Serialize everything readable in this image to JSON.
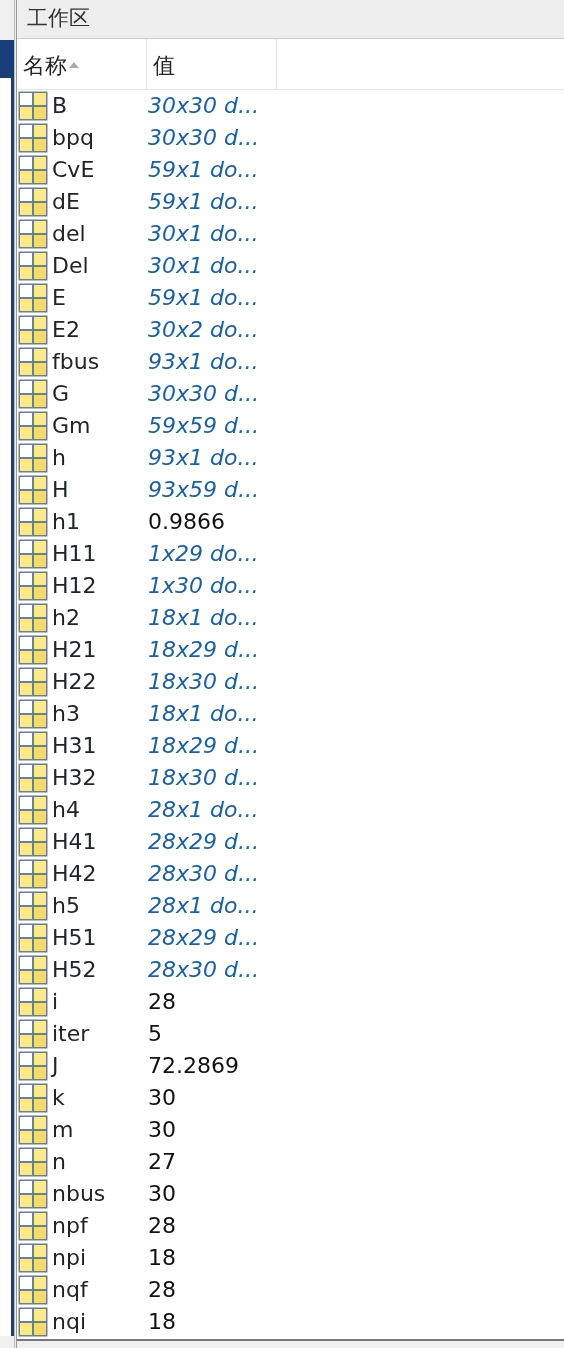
{
  "panel": {
    "title": "工作区"
  },
  "columns": [
    {
      "label": "名称",
      "sorted": true
    },
    {
      "label": "值",
      "sorted": false
    }
  ],
  "rows": [
    {
      "name": "B",
      "value": "30x30 d...",
      "kind": "summary"
    },
    {
      "name": "bpq",
      "value": "30x30 d...",
      "kind": "summary"
    },
    {
      "name": "CvE",
      "value": "59x1 do...",
      "kind": "summary"
    },
    {
      "name": "dE",
      "value": "59x1 do...",
      "kind": "summary"
    },
    {
      "name": "del",
      "value": "30x1 do...",
      "kind": "summary"
    },
    {
      "name": "Del",
      "value": "30x1 do...",
      "kind": "summary"
    },
    {
      "name": "E",
      "value": "59x1 do...",
      "kind": "summary"
    },
    {
      "name": "E2",
      "value": "30x2 do...",
      "kind": "summary"
    },
    {
      "name": "fbus",
      "value": "93x1 do...",
      "kind": "summary"
    },
    {
      "name": "G",
      "value": "30x30 d...",
      "kind": "summary"
    },
    {
      "name": "Gm",
      "value": "59x59 d...",
      "kind": "summary"
    },
    {
      "name": "h",
      "value": "93x1 do...",
      "kind": "summary"
    },
    {
      "name": "H",
      "value": "93x59 d...",
      "kind": "summary"
    },
    {
      "name": "h1",
      "value": "0.9866",
      "kind": "scalar"
    },
    {
      "name": "H11",
      "value": "1x29 do...",
      "kind": "summary"
    },
    {
      "name": "H12",
      "value": "1x30 do...",
      "kind": "summary"
    },
    {
      "name": "h2",
      "value": "18x1 do...",
      "kind": "summary"
    },
    {
      "name": "H21",
      "value": "18x29 d...",
      "kind": "summary"
    },
    {
      "name": "H22",
      "value": "18x30 d...",
      "kind": "summary"
    },
    {
      "name": "h3",
      "value": "18x1 do...",
      "kind": "summary"
    },
    {
      "name": "H31",
      "value": "18x29 d...",
      "kind": "summary"
    },
    {
      "name": "H32",
      "value": "18x30 d...",
      "kind": "summary"
    },
    {
      "name": "h4",
      "value": "28x1 do...",
      "kind": "summary"
    },
    {
      "name": "H41",
      "value": "28x29 d...",
      "kind": "summary"
    },
    {
      "name": "H42",
      "value": "28x30 d...",
      "kind": "summary"
    },
    {
      "name": "h5",
      "value": "28x1 do...",
      "kind": "summary"
    },
    {
      "name": "H51",
      "value": "28x29 d...",
      "kind": "summary"
    },
    {
      "name": "H52",
      "value": "28x30 d...",
      "kind": "summary"
    },
    {
      "name": "i",
      "value": "28",
      "kind": "scalar"
    },
    {
      "name": "iter",
      "value": "5",
      "kind": "scalar"
    },
    {
      "name": "J",
      "value": "72.2869",
      "kind": "scalar"
    },
    {
      "name": "k",
      "value": "30",
      "kind": "scalar"
    },
    {
      "name": "m",
      "value": "30",
      "kind": "scalar"
    },
    {
      "name": "n",
      "value": "27",
      "kind": "scalar"
    },
    {
      "name": "nbus",
      "value": "30",
      "kind": "scalar"
    },
    {
      "name": "npf",
      "value": "28",
      "kind": "scalar"
    },
    {
      "name": "npi",
      "value": "18",
      "kind": "scalar"
    },
    {
      "name": "nqf",
      "value": "28",
      "kind": "scalar"
    },
    {
      "name": "nqi",
      "value": "18",
      "kind": "scalar"
    }
  ]
}
